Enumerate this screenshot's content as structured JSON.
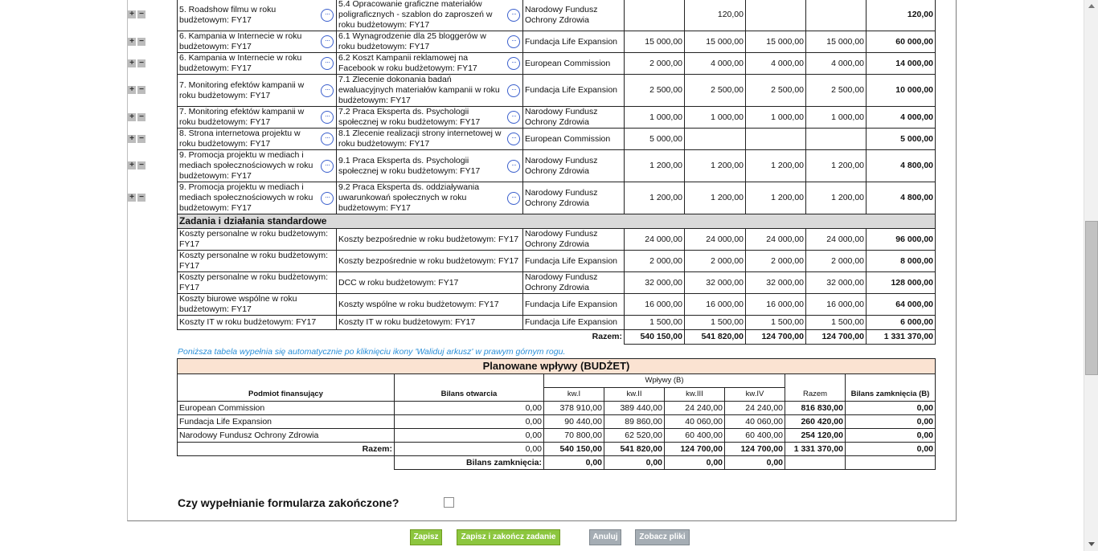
{
  "activities": [
    {
      "task": "5. Roadshow filmu w roku budżetowym: FY17",
      "action": "5.4 Opracowanie graficzne materiałów poligraficznych - szablon do zaproszeń w roku budżetowym: FY17",
      "source": "Narodowy Fundusz Ochrony Zdrowia",
      "q1": "",
      "q2": "120,00",
      "q3": "",
      "q4": "",
      "total": "120,00"
    },
    {
      "task": "6. Kampania w Internecie  w roku budżetowym: FY17",
      "action": "6.1 Wynagrodzenie dla 25 bloggerów  w roku budżetowym: FY17",
      "source": "Fundacja Life Expansion",
      "q1": "15 000,00",
      "q2": "15 000,00",
      "q3": "15 000,00",
      "q4": "15 000,00",
      "total": "60 000,00"
    },
    {
      "task": "6. Kampania w Internecie  w roku budżetowym: FY17",
      "action": "6.2 Koszt Kampanii reklamowej na Facebook  w roku budżetowym: FY17",
      "source": "European Commission",
      "q1": "2 000,00",
      "q2": "4 000,00",
      "q3": "4 000,00",
      "q4": "4 000,00",
      "total": "14 000,00"
    },
    {
      "task": "7. Monitoring efektów kampanii  w roku budżetowym: FY17",
      "action": "7.1 Zlecenie dokonania badań ewaluacyjnych materiałów kampanii w roku budżetowym: FY17",
      "source": "Fundacja Life Expansion",
      "q1": "2 500,00",
      "q2": "2 500,00",
      "q3": "2 500,00",
      "q4": "2 500,00",
      "total": "10 000,00"
    },
    {
      "task": "7. Monitoring efektów kampanii  w roku budżetowym: FY17",
      "action": "7.2 Praca Eksperta ds. Psychologii społecznej  w roku budżetowym: FY17",
      "source": "Narodowy Fundusz Ochrony Zdrowia",
      "q1": "1 000,00",
      "q2": "1 000,00",
      "q3": "1 000,00",
      "q4": "1 000,00",
      "total": "4 000,00"
    },
    {
      "task": "8. Strona internetowa projektu  w roku budżetowym: FY17",
      "action": "8.1 Zlecenie realizacji strony internetowej w roku budżetowym: FY17",
      "source": "European Commission",
      "q1": "5 000,00",
      "q2": "",
      "q3": "",
      "q4": "",
      "total": "5 000,00"
    },
    {
      "task": "9. Promocja projektu w mediach i mediach społecznościowych  w roku budżetowym: FY17",
      "action": "9.1 Praca Eksperta ds. Psychologii społecznej  w roku budżetowym: FY17",
      "source": "Narodowy Fundusz Ochrony Zdrowia",
      "q1": "1 200,00",
      "q2": "1 200,00",
      "q3": "1 200,00",
      "q4": "1 200,00",
      "total": "4 800,00"
    },
    {
      "task": "9. Promocja projektu w mediach i mediach społecznościowych  w roku budżetowym: FY17",
      "action": "9.2 Praca Eksperta ds. oddziaływania uwarunkowań społecznych w roku budżetowym: FY17",
      "source": "Narodowy Fundusz Ochrony Zdrowia",
      "q1": "1 200,00",
      "q2": "1 200,00",
      "q3": "1 200,00",
      "q4": "1 200,00",
      "total": "4 800,00"
    }
  ],
  "section_title": "Zadania i działania standardowe",
  "standard": [
    {
      "task": "Koszty personalne w roku budżetowym: FY17",
      "action": "Koszty bezpośrednie w roku budżetowym: FY17",
      "source": "Narodowy Fundusz Ochrony Zdrowia",
      "q1": "24 000,00",
      "q2": "24 000,00",
      "q3": "24 000,00",
      "q4": "24 000,00",
      "total": "96 000,00"
    },
    {
      "task": "Koszty personalne w roku budżetowym: FY17",
      "action": "Koszty bezpośrednie w roku budżetowym: FY17",
      "source": "Fundacja Life Expansion",
      "q1": "2 000,00",
      "q2": "2 000,00",
      "q3": "2 000,00",
      "q4": "2 000,00",
      "total": "8 000,00"
    },
    {
      "task": "Koszty personalne w roku budżetowym: FY17",
      "action": "DCC w roku budżetowym: FY17",
      "source": "Narodowy Fundusz Ochrony Zdrowia",
      "q1": "32 000,00",
      "q2": "32 000,00",
      "q3": "32 000,00",
      "q4": "32 000,00",
      "total": "128 000,00"
    },
    {
      "task": "Koszty biurowe wspólne w roku budżetowym: FY17",
      "action": "Koszty wspólne w roku budżetowym: FY17",
      "source": "Fundacja Life Expansion",
      "q1": "16 000,00",
      "q2": "16 000,00",
      "q3": "16 000,00",
      "q4": "16 000,00",
      "total": "64 000,00"
    },
    {
      "task": "Koszty IT w roku budżetowym: FY17",
      "action": "Koszty IT w roku budżetowym: FY17",
      "source": "Fundacja Life Expansion",
      "q1": "1 500,00",
      "q2": "1 500,00",
      "q3": "1 500,00",
      "q4": "1 500,00",
      "total": "6 000,00"
    }
  ],
  "totals": {
    "label": "Razem:",
    "q1": "540 150,00",
    "q2": "541 820,00",
    "q3": "124 700,00",
    "q4": "124 700,00",
    "total": "1 331 370,00"
  },
  "note": "Poniższa tabela wypełnia się automatycznie po kliknięciu ikony 'Waliduj arkusz' w prawym górnym rogu.",
  "budget": {
    "title": "Planowane wpływy (BUDŻET)",
    "headers": {
      "funder": "Podmiot finansujący",
      "opening": "Bilans otwarcia",
      "inflows": "Wpływy (B)",
      "q1": "kw.I",
      "q2": "kw.II",
      "q3": "kw.III",
      "q4": "kw.IV",
      "sum": "Razem",
      "closing": "Bilans zamknięcia (B)"
    },
    "rows": [
      {
        "name": "European Commission",
        "opening": "0,00",
        "q1": "378 910,00",
        "q2": "389 440,00",
        "q3": "24 240,00",
        "q4": "24 240,00",
        "sum": "816 830,00",
        "closing": "0,00"
      },
      {
        "name": "Fundacja Life Expansion",
        "opening": "0,00",
        "q1": "90 440,00",
        "q2": "89 860,00",
        "q3": "40 060,00",
        "q4": "40 060,00",
        "sum": "260 420,00",
        "closing": "0,00"
      },
      {
        "name": "Narodowy Fundusz Ochrony Zdrowia",
        "opening": "0,00",
        "q1": "70 800,00",
        "q2": "62 520,00",
        "q3": "60 400,00",
        "q4": "60 400,00",
        "sum": "254 120,00",
        "closing": "0,00"
      }
    ],
    "total": {
      "label": "Razem:",
      "opening": "0,00",
      "q1": "540 150,00",
      "q2": "541 820,00",
      "q3": "124 700,00",
      "q4": "124 700,00",
      "sum": "1 331 370,00",
      "closing": "0,00"
    },
    "closing_row": {
      "label": "Bilans zamknięcia:",
      "q1": "0,00",
      "q2": "0,00",
      "q3": "0,00",
      "q4": "0,00"
    }
  },
  "question": "Czy wypełnianie formularza zakończone?",
  "buttons": {
    "save": "Zapisz",
    "save_finish": "Zapisz i zakończ zadanie",
    "cancel": "Anuluj",
    "files": "Zobacz pliki"
  },
  "colors": {
    "required_star": "#e0302a",
    "note": "#2a8fd8",
    "budget_header": "#fbe3d2",
    "section_header": "#d9d9d9",
    "btn_green": "#8cc63e",
    "btn_gray": "#a5adb4",
    "more_icon": "#3a5fcd"
  }
}
